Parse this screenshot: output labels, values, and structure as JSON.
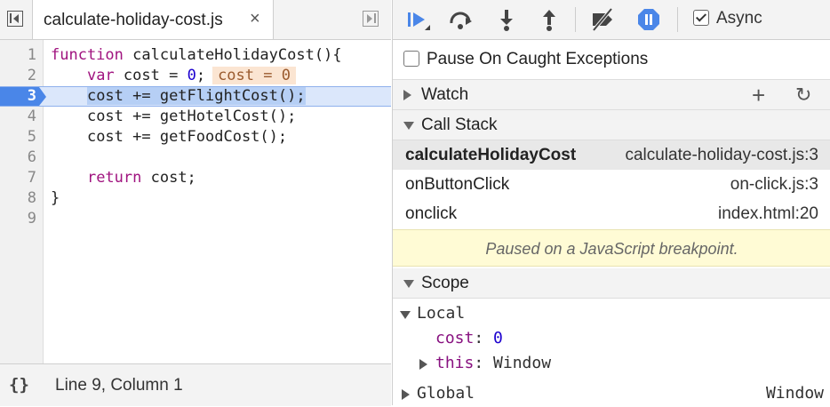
{
  "editor": {
    "tab_title": "calculate-holiday-cost.js",
    "close_glyph": "×",
    "lines": [
      {
        "n": "1"
      },
      {
        "n": "2"
      },
      {
        "n": "3"
      },
      {
        "n": "4"
      },
      {
        "n": "5"
      },
      {
        "n": "6"
      },
      {
        "n": "7"
      },
      {
        "n": "8"
      },
      {
        "n": "9"
      }
    ],
    "code": {
      "l1_kw": "function",
      "l1_rest": " calculateHolidayCost(){",
      "l2_kw": "var",
      "l2_mid": " cost = ",
      "l2_num": "0",
      "l2_end": ";",
      "l2_inline": "cost = 0",
      "l3": "cost += getFlightCost();",
      "l4": "cost += getHotelCost();",
      "l5": "cost += getFoodCost();",
      "l7_kw": "return",
      "l7_rest": " cost;",
      "l8": "}"
    },
    "breakpoint_line": 3
  },
  "statusbar": {
    "braces": "{}",
    "position": "Line 9, Column 1"
  },
  "debugger": {
    "async_label": "Async",
    "async_checked": true,
    "pause_on_caught": "Pause On Caught Exceptions",
    "watch_label": "Watch",
    "plus_glyph": "+",
    "refresh_glyph": "↻",
    "call_stack_label": "Call Stack",
    "call_stack": [
      {
        "fn": "calculateHolidayCost",
        "loc": "calculate-holiday-cost.js:3",
        "selected": true
      },
      {
        "fn": "onButtonClick",
        "loc": "on-click.js:3",
        "selected": false
      },
      {
        "fn": "onclick",
        "loc": "index.html:20",
        "selected": false
      }
    ],
    "paused_message": "Paused on a JavaScript breakpoint.",
    "scope_label": "Scope",
    "scope": {
      "local_label": "Local",
      "cost_key": "cost",
      "cost_val": "0",
      "this_key": "this",
      "this_val": "Window",
      "global_label": "Global",
      "global_val": "Window",
      "colon": ":"
    }
  },
  "colors": {
    "accent": "#4a86e8",
    "breakpoint_row": "#dbe7fb",
    "paused_bg": "#fffbd5"
  }
}
